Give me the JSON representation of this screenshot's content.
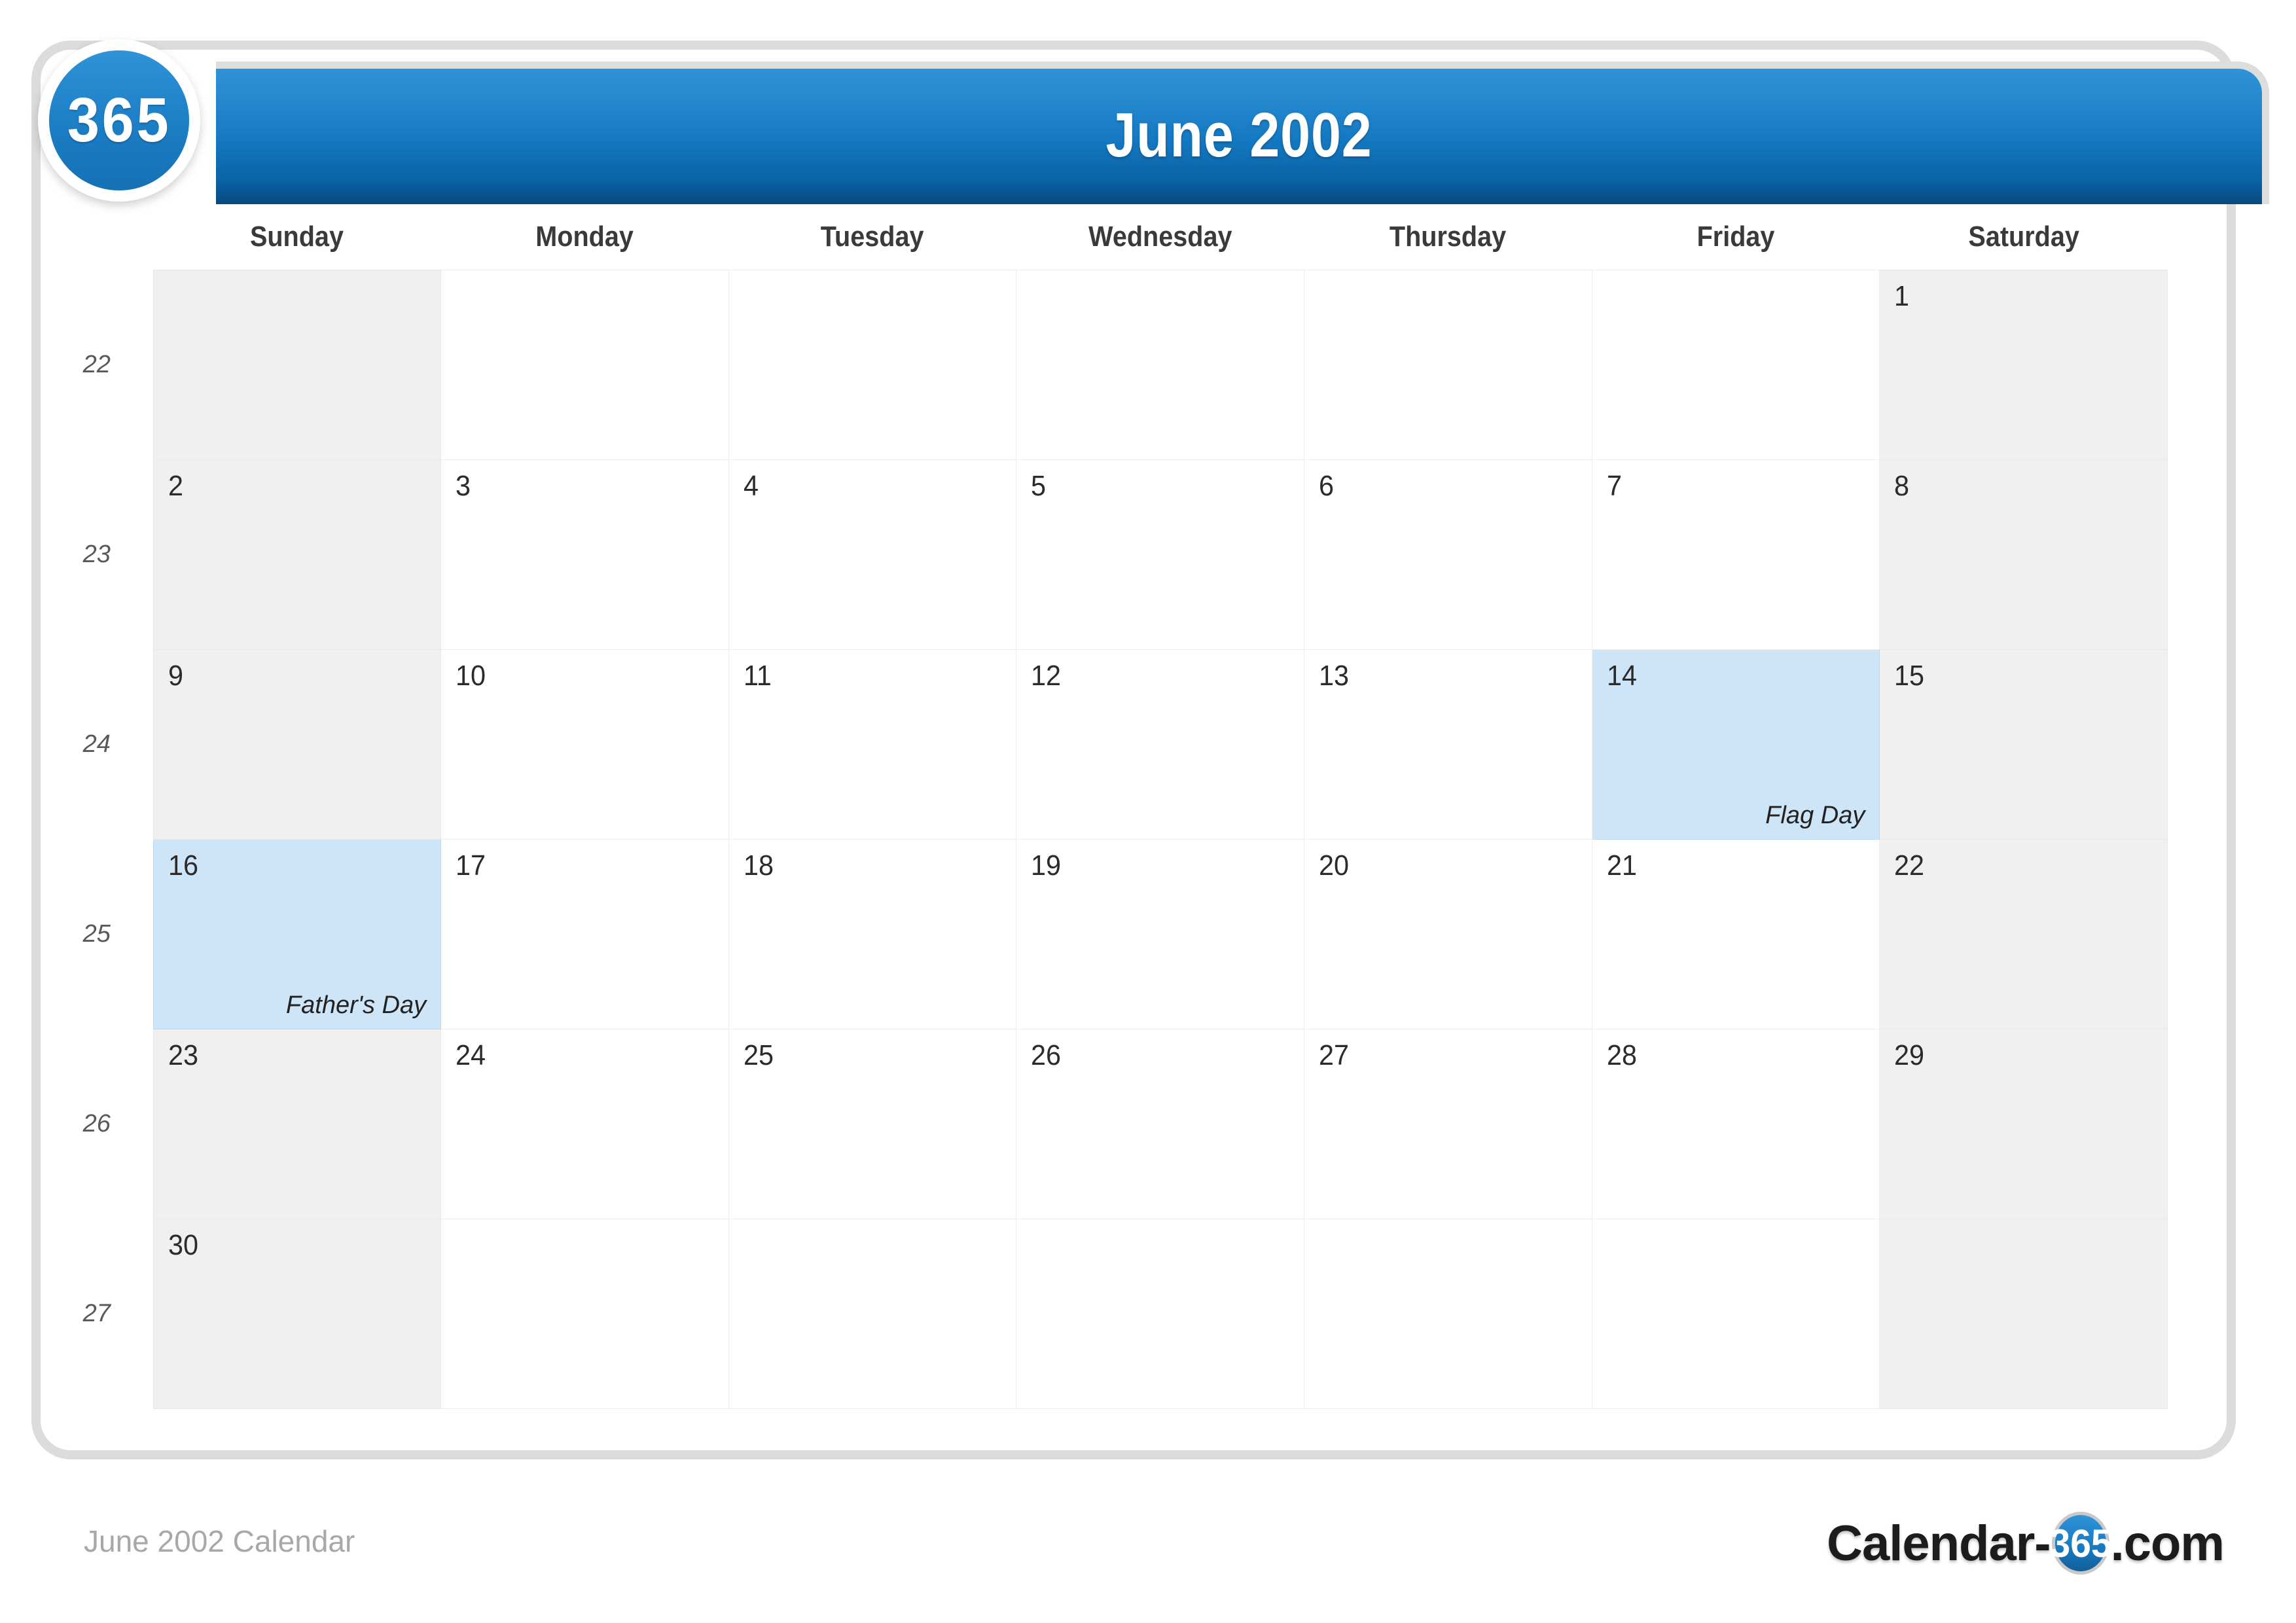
{
  "brand": {
    "badge_text": "365",
    "accent_blue": "#1a7cc3",
    "header_gradient_top": "#2f93d8",
    "header_gradient_bottom": "#06497f",
    "weekend_bg": "#f0f0f0",
    "highlight_bg": "#cee4f7"
  },
  "header": {
    "title": "June 2002"
  },
  "watermark": {
    "text": "365"
  },
  "calendar": {
    "week_number_header": "",
    "weekdays": [
      "Sunday",
      "Monday",
      "Tuesday",
      "Wednesday",
      "Thursday",
      "Friday",
      "Saturday"
    ],
    "weeks": [
      {
        "week_number": "22",
        "days": [
          {
            "date": "",
            "event": "",
            "weekend": true,
            "highlight": false
          },
          {
            "date": "",
            "event": "",
            "weekend": false,
            "highlight": false
          },
          {
            "date": "",
            "event": "",
            "weekend": false,
            "highlight": false
          },
          {
            "date": "",
            "event": "",
            "weekend": false,
            "highlight": false
          },
          {
            "date": "",
            "event": "",
            "weekend": false,
            "highlight": false
          },
          {
            "date": "",
            "event": "",
            "weekend": false,
            "highlight": false
          },
          {
            "date": "1",
            "event": "",
            "weekend": true,
            "highlight": false
          }
        ]
      },
      {
        "week_number": "23",
        "days": [
          {
            "date": "2",
            "event": "",
            "weekend": true,
            "highlight": false
          },
          {
            "date": "3",
            "event": "",
            "weekend": false,
            "highlight": false
          },
          {
            "date": "4",
            "event": "",
            "weekend": false,
            "highlight": false
          },
          {
            "date": "5",
            "event": "",
            "weekend": false,
            "highlight": false
          },
          {
            "date": "6",
            "event": "",
            "weekend": false,
            "highlight": false
          },
          {
            "date": "7",
            "event": "",
            "weekend": false,
            "highlight": false
          },
          {
            "date": "8",
            "event": "",
            "weekend": true,
            "highlight": false
          }
        ]
      },
      {
        "week_number": "24",
        "days": [
          {
            "date": "9",
            "event": "",
            "weekend": true,
            "highlight": false
          },
          {
            "date": "10",
            "event": "",
            "weekend": false,
            "highlight": false
          },
          {
            "date": "11",
            "event": "",
            "weekend": false,
            "highlight": false
          },
          {
            "date": "12",
            "event": "",
            "weekend": false,
            "highlight": false
          },
          {
            "date": "13",
            "event": "",
            "weekend": false,
            "highlight": false
          },
          {
            "date": "14",
            "event": "Flag Day",
            "weekend": false,
            "highlight": true
          },
          {
            "date": "15",
            "event": "",
            "weekend": true,
            "highlight": false
          }
        ]
      },
      {
        "week_number": "25",
        "days": [
          {
            "date": "16",
            "event": "Father's Day",
            "weekend": true,
            "highlight": true
          },
          {
            "date": "17",
            "event": "",
            "weekend": false,
            "highlight": false
          },
          {
            "date": "18",
            "event": "",
            "weekend": false,
            "highlight": false
          },
          {
            "date": "19",
            "event": "",
            "weekend": false,
            "highlight": false
          },
          {
            "date": "20",
            "event": "",
            "weekend": false,
            "highlight": false
          },
          {
            "date": "21",
            "event": "",
            "weekend": false,
            "highlight": false
          },
          {
            "date": "22",
            "event": "",
            "weekend": true,
            "highlight": false
          }
        ]
      },
      {
        "week_number": "26",
        "days": [
          {
            "date": "23",
            "event": "",
            "weekend": true,
            "highlight": false
          },
          {
            "date": "24",
            "event": "",
            "weekend": false,
            "highlight": false
          },
          {
            "date": "25",
            "event": "",
            "weekend": false,
            "highlight": false
          },
          {
            "date": "26",
            "event": "",
            "weekend": false,
            "highlight": false
          },
          {
            "date": "27",
            "event": "",
            "weekend": false,
            "highlight": false
          },
          {
            "date": "28",
            "event": "",
            "weekend": false,
            "highlight": false
          },
          {
            "date": "29",
            "event": "",
            "weekend": true,
            "highlight": false
          }
        ]
      },
      {
        "week_number": "27",
        "days": [
          {
            "date": "30",
            "event": "",
            "weekend": true,
            "highlight": false
          },
          {
            "date": "",
            "event": "",
            "weekend": false,
            "highlight": false
          },
          {
            "date": "",
            "event": "",
            "weekend": false,
            "highlight": false
          },
          {
            "date": "",
            "event": "",
            "weekend": false,
            "highlight": false
          },
          {
            "date": "",
            "event": "",
            "weekend": false,
            "highlight": false
          },
          {
            "date": "",
            "event": "",
            "weekend": false,
            "highlight": false
          },
          {
            "date": "",
            "event": "",
            "weekend": true,
            "highlight": false
          }
        ]
      }
    ]
  },
  "footer": {
    "caption": "June 2002 Calendar",
    "logo_prefix": "Calendar-",
    "logo_badge": "365",
    "logo_suffix": ".com"
  }
}
